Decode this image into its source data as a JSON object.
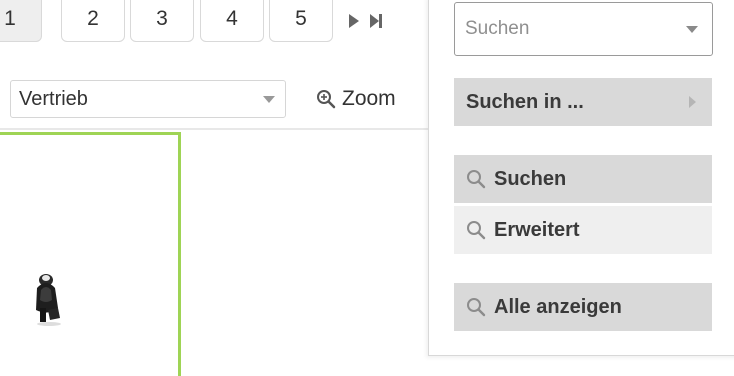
{
  "pagination": {
    "pages": [
      "1",
      "2",
      "3",
      "4",
      "5"
    ],
    "active_page": "1",
    "next_icon": "play-icon",
    "last_icon": "skip-end-icon"
  },
  "toolbar": {
    "category_value": "Vertrieb",
    "zoom_label": "Zoom",
    "zoom_icon": "zoom-in-icon"
  },
  "search_panel": {
    "select_placeholder": "Suchen",
    "search_in_label": "Suchen in ...",
    "search_label": "Suchen",
    "advanced_label": "Erweitert",
    "show_all_label": "Alle anzeigen",
    "search_icon": "magnifier-icon"
  },
  "colors": {
    "accent_green": "#9fd455",
    "item_bg": "#d9d9d9",
    "item_bg_light": "#efefef"
  }
}
